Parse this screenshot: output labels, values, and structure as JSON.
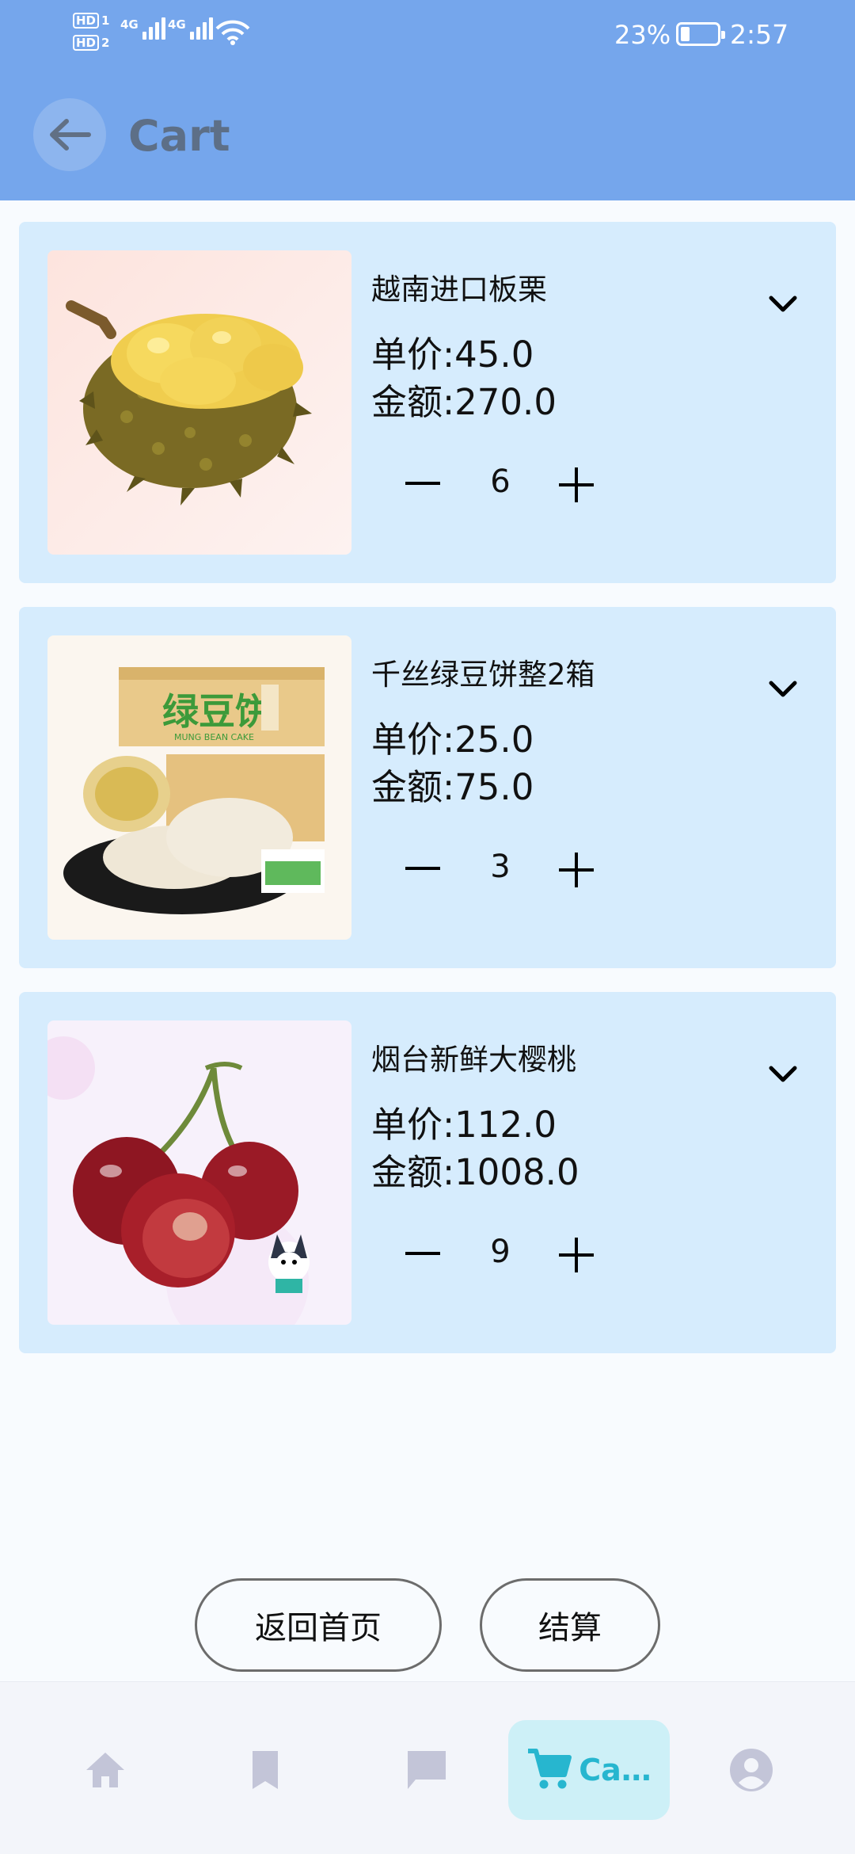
{
  "status_bar": {
    "sim1_label": "HD",
    "sim1_num": "1",
    "sim2_label": "HD",
    "sim2_num": "2",
    "network1": "4G",
    "network2": "4G",
    "battery_percent": "23%",
    "time": "2:57"
  },
  "header": {
    "title": "Cart",
    "color": "#75a6ec"
  },
  "cart_items": [
    {
      "name": "越南进口板栗",
      "unit_price": "单价:45.0",
      "total": "金额:270.0",
      "quantity": "6",
      "image": "durian"
    },
    {
      "name": "千丝绿豆饼整2箱",
      "unit_price": "单价:25.0",
      "total": "金额:75.0",
      "quantity": "3",
      "image": "mung-bean-cake",
      "box_text": "绿豆饼",
      "box_subtext": "MUNG BEAN CAKE"
    },
    {
      "name": "烟台新鲜大樱桃",
      "unit_price": "单价:112.0",
      "total": "金额:1008.0",
      "quantity": "9",
      "image": "cherries"
    }
  ],
  "actions": {
    "home_label": "返回首页",
    "checkout_label": "结算"
  },
  "bottom_nav": {
    "items": [
      {
        "icon": "home-icon"
      },
      {
        "icon": "bookmark-icon"
      },
      {
        "icon": "chat-icon"
      },
      {
        "icon": "cart-icon",
        "label": "Ca…",
        "active": true
      },
      {
        "icon": "profile-icon"
      }
    ],
    "active_color": "#27b6cf"
  }
}
